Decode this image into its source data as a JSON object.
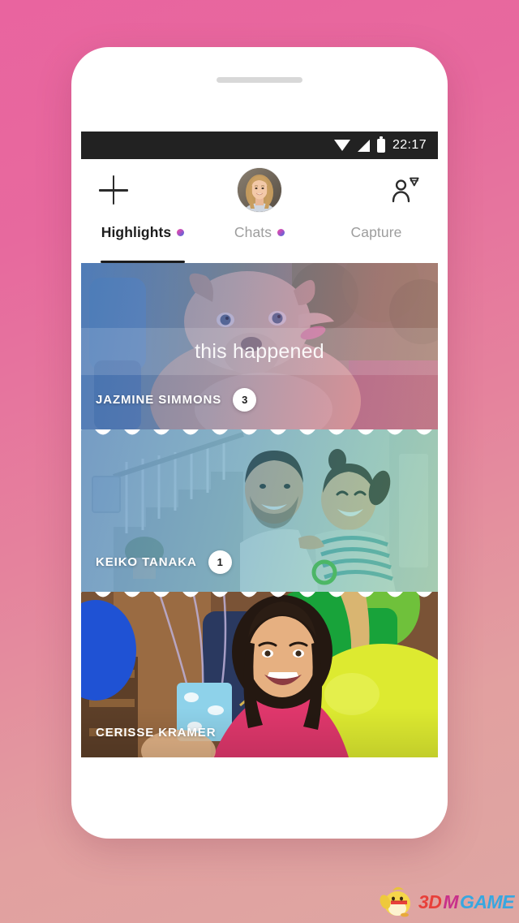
{
  "device": {
    "speaker": "speaker-grille"
  },
  "statusbar": {
    "time": "22:17",
    "icons": [
      "wifi-icon",
      "cellular-signal-icon",
      "battery-icon"
    ]
  },
  "header": {
    "add_label": "+",
    "add_icon": "plus-icon",
    "avatar_alt": "user-avatar",
    "friends_icon": "add-friend-icon"
  },
  "tabs": [
    {
      "label": "Highlights",
      "active": true,
      "dot": true
    },
    {
      "label": "Chats",
      "active": false,
      "dot": true
    },
    {
      "label": "Capture",
      "active": false,
      "dot": false
    }
  ],
  "feed": {
    "banner_text": "this happened",
    "cards": [
      {
        "name": "JAZMINE SIMMONS",
        "count": "3",
        "scene": "fluffy-dog-on-trampoline",
        "tint": "blue-pink"
      },
      {
        "name": "KEIKO TANAKA",
        "count": "1",
        "scene": "man-holding-toddler-indoors",
        "tint": "blue-teal"
      },
      {
        "name": "CERISSE KRAMER",
        "count": "",
        "scene": "girl-with-balloons-at-party",
        "tint": "none"
      }
    ]
  },
  "watermark": {
    "part1": "3D",
    "part2": "M",
    "part3": "GAME",
    "mascot": "chick-mascot-icon"
  },
  "colors": {
    "background_top": "#e9649f",
    "background_bottom": "#dea6a2",
    "statusbar": "#222222",
    "tab_active": "#1d1d1d",
    "tab_inactive": "#9d9d9d",
    "dot_gradient_start": "#f0529c",
    "dot_gradient_end": "#3d6fe0",
    "badge_bg": "#ffffff"
  }
}
